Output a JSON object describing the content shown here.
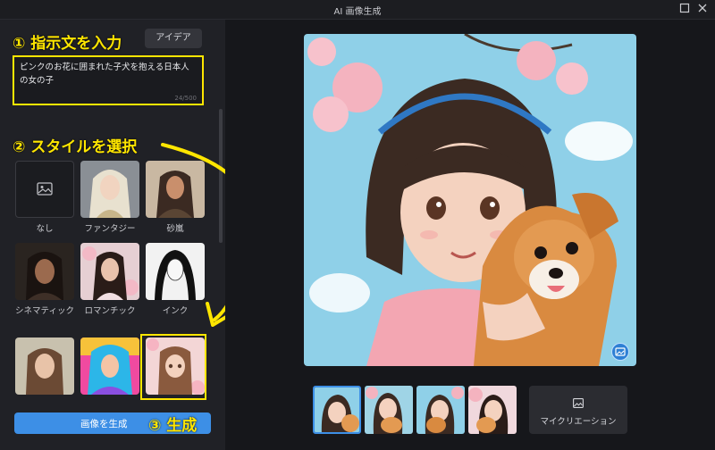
{
  "window": {
    "title": "AI 画像生成"
  },
  "left_panel": {
    "step1_label": "① 指示文を入力",
    "idea_button": "アイデア",
    "prompt_text": "ピンクのお花に囲まれた子犬を抱える日本人の女の子",
    "prompt_count": "24/500",
    "step2_label": "② スタイルを選択",
    "styles": [
      {
        "label": "なし"
      },
      {
        "label": "ファンタジー"
      },
      {
        "label": "砂嵐"
      },
      {
        "label": "シネマティック"
      },
      {
        "label": "ロマンチック"
      },
      {
        "label": "インク"
      },
      {
        "label": ""
      },
      {
        "label": ""
      },
      {
        "label": ""
      }
    ],
    "generate_button": "画像を生成",
    "step3_label": "③ 生成"
  },
  "right_panel": {
    "my_creation_button": "マイクリエーション"
  },
  "colors": {
    "accent_blue": "#3d8fe6",
    "annotation_yellow": "#ffe600",
    "panel_bg": "#202126",
    "main_bg": "#16171b"
  }
}
